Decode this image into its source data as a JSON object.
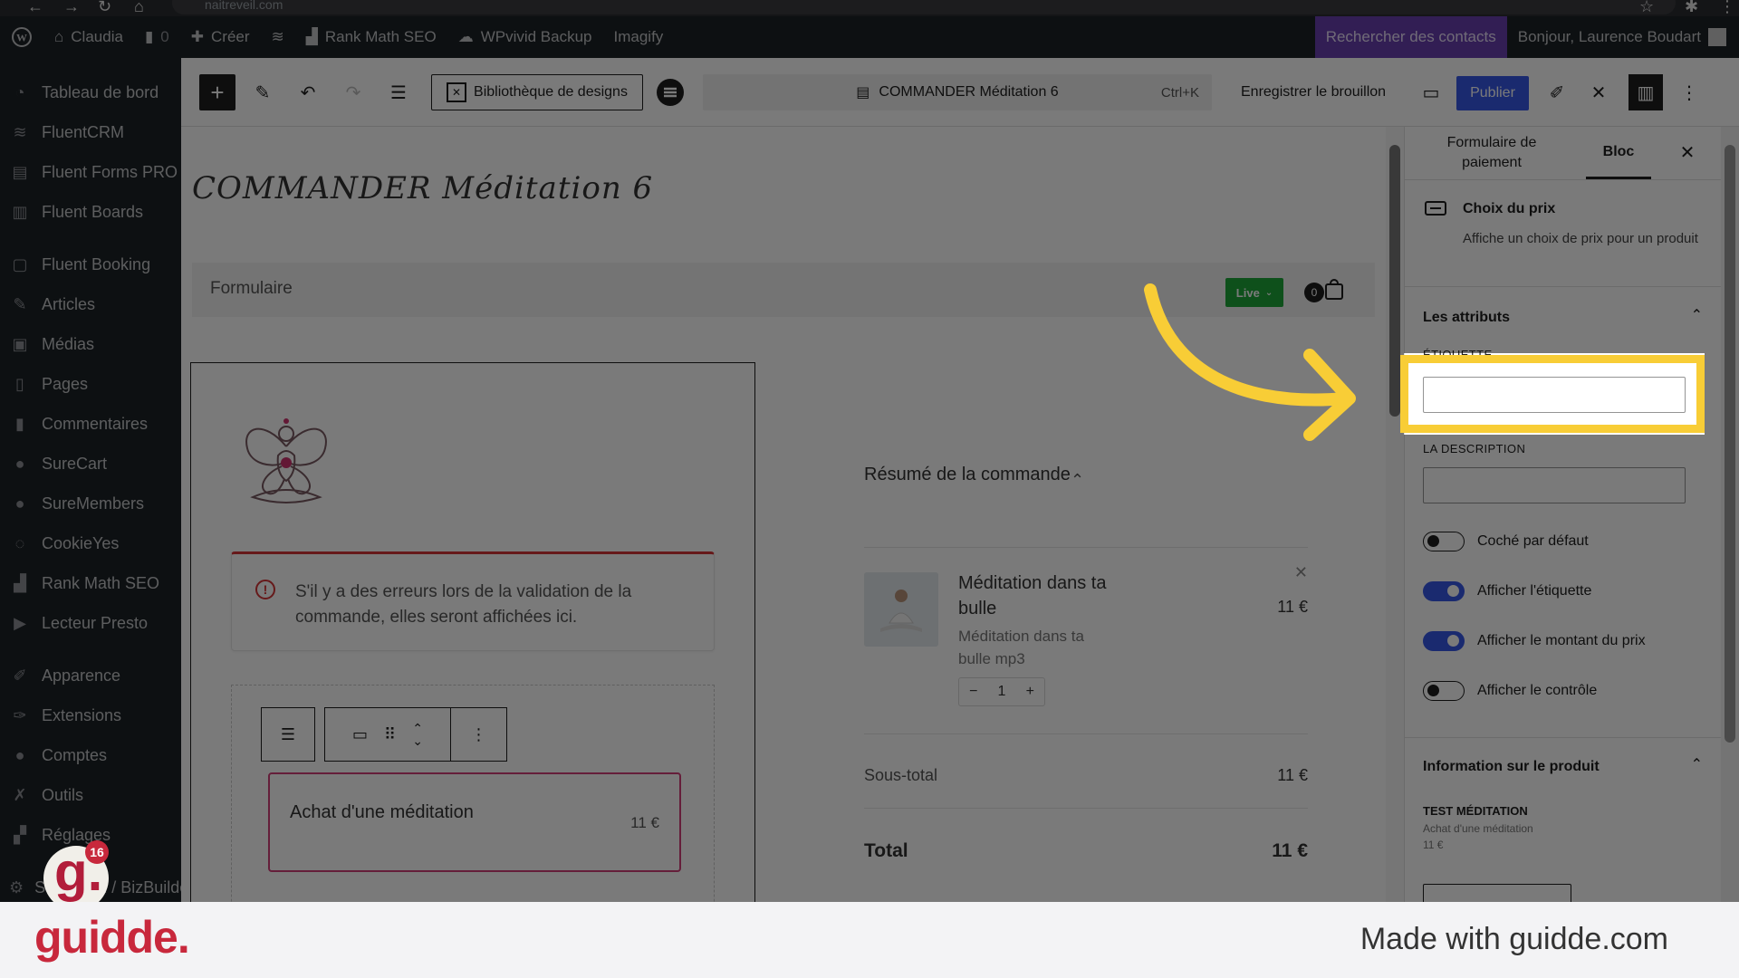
{
  "browser": {
    "url": "naitreveil.com"
  },
  "adminbar": {
    "site_name": "Claudia",
    "comments_count": "0",
    "create_label": "Créer",
    "rank_math": "Rank Math SEO",
    "wpvivid": "WPvivid Backup",
    "imagify": "Imagify",
    "search_contacts": "Rechercher des contacts",
    "greeting": "Bonjour, Laurence Boudart"
  },
  "sidebar": {
    "items": [
      {
        "label": "Tableau de bord",
        "icon": "dashboard-icon"
      },
      {
        "label": "FluentCRM",
        "icon": "fluentcrm-icon"
      },
      {
        "label": "Fluent Forms PRO",
        "icon": "forms-icon"
      },
      {
        "label": "Fluent Boards",
        "icon": "boards-icon"
      },
      {
        "label": "Fluent Booking",
        "icon": "booking-icon"
      },
      {
        "label": "Articles",
        "icon": "pin-icon"
      },
      {
        "label": "Médias",
        "icon": "media-icon"
      },
      {
        "label": "Pages",
        "icon": "pages-icon"
      },
      {
        "label": "Commentaires",
        "icon": "comment-icon"
      },
      {
        "label": "SureCart",
        "icon": "surecart-icon"
      },
      {
        "label": "SureMembers",
        "icon": "suremembers-icon"
      },
      {
        "label": "CookieYes",
        "icon": "cookie-icon"
      },
      {
        "label": "Rank Math SEO",
        "icon": "rankmath-icon"
      },
      {
        "label": "Lecteur Presto",
        "icon": "presto-icon"
      },
      {
        "label": "Apparence",
        "icon": "brush-icon"
      },
      {
        "label": "Extensions",
        "icon": "plugin-icon"
      },
      {
        "label": "Comptes",
        "icon": "user-icon"
      },
      {
        "label": "Outils",
        "icon": "wrench-icon"
      },
      {
        "label": "Réglages",
        "icon": "settings-icon"
      },
      {
        "label": "SeedProd / BizBuilder",
        "icon": "gear-icon"
      }
    ]
  },
  "toolbar": {
    "design_library": "Bibliothèque de designs",
    "command_title": "COMMANDER Méditation 6",
    "shortcut": "Ctrl+K",
    "save_draft": "Enregistrer le brouillon",
    "publish": "Publier"
  },
  "canvas": {
    "page_title": "COMMANDER Méditation 6",
    "form_label": "Formulaire",
    "live_badge": "Live",
    "cart_count": "0",
    "error_notice": "S'il y a des erreurs lors de la validation de la commande, elles seront affichées ici.",
    "price_choice_name": "Achat d'une méditation",
    "price_choice_price": "11 €",
    "summary_heading": "Résumé de la commande",
    "item_title": "Méditation dans ta bulle",
    "item_subtitle": "Méditation dans ta bulle mp3",
    "item_price": "11 €",
    "quantity": "1",
    "qty_minus": "−",
    "qty_plus": "+",
    "subtotal_label": "Sous-total",
    "subtotal_value": "11 €",
    "total_label": "Total",
    "total_value": "11 €"
  },
  "panel": {
    "tab_form": "Formulaire de paiement",
    "tab_block": "Bloc",
    "block_title": "Choix du prix",
    "block_desc": "Affiche un choix de prix pour un produit",
    "attributes_title": "Les attributs",
    "label_field_label": "ÉTIQUETTE",
    "label_value": "",
    "description_label": "LA DESCRIPTION",
    "description_value": "",
    "toggles": [
      {
        "label": "Coché par défaut",
        "on": false
      },
      {
        "label": "Afficher l'étiquette",
        "on": true
      },
      {
        "label": "Afficher le montant du prix",
        "on": true
      },
      {
        "label": "Afficher le contrôle",
        "on": false
      }
    ],
    "product_section_title": "Information sur le produit",
    "product_name": "TEST MÉDITATION",
    "product_price_name": "Achat d'une méditation",
    "product_price": "11 €"
  },
  "colors": {
    "highlight": "#f8cd36",
    "accent": "#3858e9",
    "error": "#d63638",
    "live": "#1ea83a",
    "brand": "#c8283c"
  },
  "branding": {
    "avatar_letter": "g.",
    "notifications": "16",
    "logo": "guidde.",
    "made_with": "Made with guidde.com"
  }
}
